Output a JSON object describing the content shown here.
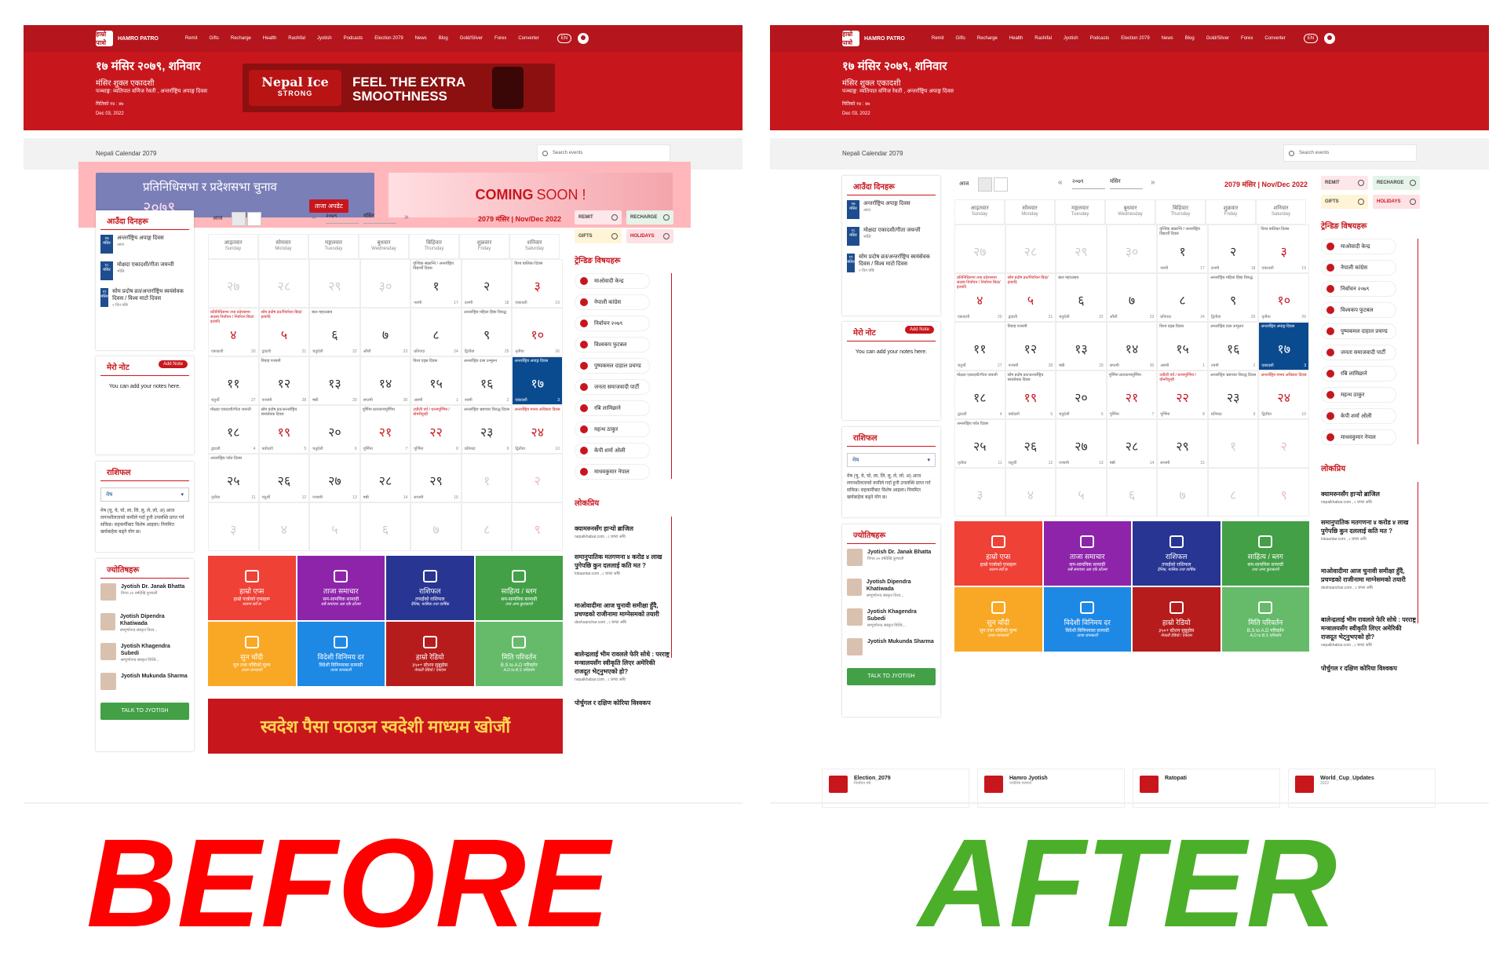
{
  "nav": {
    "brand": "HAMRO PATRO",
    "logo_text": "हाम्रो पात्रो",
    "items": [
      "Remit",
      "Gifts",
      "Recharge",
      "Health",
      "Rashifal",
      "Jyotish",
      "Podcasts",
      "Election 2079",
      "News",
      "Blog",
      "Gold/Silver",
      "Forex",
      "Converter"
    ],
    "lang": "EN"
  },
  "hero": {
    "date": "१७ मंसिर २०७९, शनिवार",
    "tithi": "मंसिर शुक्ल एकादशी",
    "event": "पञ्चाङ्ग: व्यतिपात वणिज रेवती , अन्तर्राष्ट्रिय अपाङ्ग दिवस",
    "sub": "मितिको १४ : ४७",
    "eng": "Dec 03, 2022",
    "ad_brand_1": "Nepal Ice",
    "ad_brand_2": "STRONG",
    "ad_tag": "FEEL THE EXTRA SMOOTHNESS"
  },
  "subheader": {
    "title": "Nepali Calendar 2079",
    "search_placeholder": "Search events"
  },
  "highlight_ads": {
    "election_1": "प्रतिनिधिसभा र प्रदेशसभा चुनाव",
    "election_2": "२०७९",
    "election_btn": "ताजा अपडेट",
    "coming_bold": "COMING",
    "coming_rest": "SOON !"
  },
  "upcoming": {
    "title": "आउँदा दिनहरू",
    "events": [
      {
        "badge": "१७ मंसिर",
        "text": "अन्तर्राष्ट्रिय अपाङ्ग दिवस",
        "sub": "आज"
      },
      {
        "badge": "१८ मंसिर",
        "text": "मोक्षदा एकादशी/गीता जयन्ती",
        "sub": "भोलि"
      },
      {
        "badge": "१९ मंसिर",
        "text": "सोम प्रदोष व्रत/अन्तर्राष्ट्रिय स्वयंसेवक दिवस / विश्व माटो दिवस",
        "sub": "२ दिन पछि"
      }
    ]
  },
  "notes": {
    "title": "मेरो नोट",
    "add": "Add Note",
    "empty": "You can add your notes here."
  },
  "rashifal": {
    "title": "राशिफल",
    "selected": "मेष",
    "text": "मेष (चु, चे, चो, ला, लि, लु, ले, लो, अ) आज लगनशीलताको कमीले गर्दा हुनी उपलब्धि प्राप्त गर्न सकिन्न। सहकर्मीबाट विशेष आइला। नियमित खर्चबाहेक बढ्ने योग छ।"
  },
  "jyotish": {
    "title": "ज्योतिषहरू",
    "before": [
      {
        "name": "Jyotish Dr. Janak Bhatta",
        "sub": "विगत ३५ वर्षदेखि कुण्डली"
      },
      {
        "name": "Jyotish Dipendra Khatiwada",
        "sub": "सम्पूर्णानन्द संस्कृत विश्व..."
      },
      {
        "name": "Jyotish Khagendra Subedi",
        "sub": "सम्पूर्णानन्द संस्कृत विश्वि..."
      },
      {
        "name": "Jyotish Mukunda Sharma",
        "sub": ""
      }
    ],
    "talk": "TALK TO JYOTISH"
  },
  "calendar": {
    "today_label": "आज",
    "year": "२०७९",
    "month": "मंसिर",
    "heading": "2079 मंसिर | Nov/Dec 2022",
    "days": [
      {
        "np": "आइतवार",
        "en": "Sunday"
      },
      {
        "np": "सोमवार",
        "en": "Monday"
      },
      {
        "np": "मङ्गलवार",
        "en": "Tuesday"
      },
      {
        "np": "बुधवार",
        "en": "Wednesday"
      },
      {
        "np": "बिहिवार",
        "en": "Thursday"
      },
      {
        "np": "शुक्रवार",
        "en": "Friday"
      },
      {
        "np": "शनिवार",
        "en": "Saturday"
      }
    ],
    "cells": [
      {
        "n": "२७",
        "f": true,
        "ev": "",
        "t": "",
        "e": ""
      },
      {
        "n": "२८",
        "f": true,
        "ev": "",
        "t": "",
        "e": ""
      },
      {
        "n": "२९",
        "f": true,
        "ev": "",
        "t": "",
        "e": ""
      },
      {
        "n": "३०",
        "f": true,
        "ev": "",
        "t": "",
        "e": ""
      },
      {
        "n": "१",
        "ev": "वृश्चिक संक्रान्ति / अन्तर्राष्ट्रिय विद्यार्थी दिवस",
        "t": "नवमी",
        "e": "17"
      },
      {
        "n": "२",
        "ev": "",
        "t": "दशमी",
        "e": "18"
      },
      {
        "n": "३",
        "r": true,
        "ev": "विश्व बालिका दिवस",
        "t": "एकादशी",
        "e": "19"
      },
      {
        "n": "४",
        "r": true,
        "ev": "प्रतिनिधिसभा तथा प्रदेशसभा सदस्य निर्वाचन / निर्वाचन बिदा/इत्यादि",
        "er": true,
        "t": "एकादशी",
        "e": "20"
      },
      {
        "n": "५",
        "r": true,
        "ev": "सोम प्रदोष व्रत/निर्वाचन बिदा/इत्यादि",
        "er": true,
        "t": "द्वादशी",
        "e": "21"
      },
      {
        "n": "६",
        "ev": "बाल महाउत्सव",
        "t": "चतुर्दशी",
        "e": "22"
      },
      {
        "n": "७",
        "ev": "",
        "t": "औंशी",
        "e": "23"
      },
      {
        "n": "८",
        "ev": "",
        "t": "प्रतिपदा",
        "e": "24"
      },
      {
        "n": "९",
        "ev": "अन्तर्राष्ट्रिय महिला हिंसा विरुद्ध",
        "t": "द्वितीया",
        "e": "25"
      },
      {
        "n": "१०",
        "r": true,
        "ev": "",
        "t": "तृतीया",
        "e": "26"
      },
      {
        "n": "११",
        "ev": "",
        "t": "चतुर्थी",
        "e": "27"
      },
      {
        "n": "१२",
        "ev": "विवाह पञ्चमी",
        "t": "पञ्चमी",
        "e": "28"
      },
      {
        "n": "१३",
        "ev": "",
        "t": "षष्ठी",
        "e": "29"
      },
      {
        "n": "१४",
        "ev": "",
        "t": "सप्तमी",
        "e": "30"
      },
      {
        "n": "१५",
        "ev": "विश्व एड्स दिवस",
        "t": "अष्टमी",
        "e": "1"
      },
      {
        "n": "१६",
        "ev": "अन्तर्राष्ट्रिय दास उन्मूलन",
        "t": "नवमी",
        "e": "2"
      },
      {
        "n": "१७",
        "today": true,
        "ev": "अन्तर्राष्ट्रिय अपाङ्ग दिवस",
        "t": "एकादशी",
        "e": "3"
      },
      {
        "n": "१८",
        "ev": "मोक्षदा एकादशी/गीता जयन्ती",
        "t": "द्वादशी",
        "e": "4"
      },
      {
        "n": "१९",
        "r": true,
        "ev": "सोम प्रदोष व्रत/अन्तर्राष्ट्रिय स्वयंसेवक दिवस",
        "t": "त्रयोदशी",
        "e": "5"
      },
      {
        "n": "२०",
        "ev": "",
        "t": "चतुर्दशी",
        "e": "6"
      },
      {
        "n": "२१",
        "r": true,
        "ev": "पूर्णिमा व्रत/धान्यपूर्णिमा",
        "t": "पूर्णिमा",
        "e": "7"
      },
      {
        "n": "२२",
        "r": true,
        "ev": "उधौली पर्व / धान्यपूर्णिमा / योमरीपुन्ही",
        "er": true,
        "t": "पूर्णिमा",
        "e": "8"
      },
      {
        "n": "२३",
        "ev": "अन्तर्राष्ट्रिय भ्रष्टाचार विरुद्ध दिवस",
        "t": "प्रतिपदा",
        "e": "9"
      },
      {
        "n": "२४",
        "r": true,
        "ev": "अन्तर्राष्ट्रिय मानव अधिकार दिवस",
        "er": true,
        "t": "द्वितीया",
        "e": "10"
      },
      {
        "n": "२५",
        "ev": "अन्तर्राष्ट्रिय पर्वत दिवस",
        "t": "तृतीया",
        "e": "11"
      },
      {
        "n": "२६",
        "ev": "",
        "t": "चतुर्थी",
        "e": "12"
      },
      {
        "n": "२७",
        "ev": "",
        "t": "पञ्चमी",
        "e": "13"
      },
      {
        "n": "२८",
        "ev": "",
        "t": "षष्ठी",
        "e": "14"
      },
      {
        "n": "२९",
        "ev": "",
        "t": "सप्तमी",
        "e": "15"
      },
      {
        "n": "१",
        "f": true,
        "ev": "",
        "t": "",
        "e": ""
      },
      {
        "n": "२",
        "f": true,
        "r": true,
        "ev": "",
        "t": "",
        "e": ""
      },
      {
        "n": "३",
        "f": true,
        "ev": "",
        "t": "",
        "e": ""
      },
      {
        "n": "४",
        "f": true,
        "ev": "",
        "t": "",
        "e": ""
      },
      {
        "n": "५",
        "f": true,
        "ev": "",
        "t": "",
        "e": ""
      },
      {
        "n": "६",
        "f": true,
        "ev": "",
        "t": "",
        "e": ""
      },
      {
        "n": "७",
        "f": true,
        "ev": "",
        "t": "",
        "e": ""
      },
      {
        "n": "८",
        "f": true,
        "ev": "",
        "t": "",
        "e": ""
      },
      {
        "n": "९",
        "f": true,
        "r": true,
        "ev": "",
        "t": "",
        "e": ""
      }
    ]
  },
  "tiles": [
    {
      "t": "हाम्रो एप्स",
      "s": "हाम्रो पात्रोको एप्सहरू",
      "s2": "सलग्न सर्वे छ",
      "c": "#ef4136"
    },
    {
      "t": "ताजा समाचार",
      "s": "सम-सामयिक सामाग्री",
      "s2": "सबै समाचार अब एकै ठाँउमा",
      "c": "#8e24aa"
    },
    {
      "t": "राशिफल",
      "s": "तपाईंको राशिफल",
      "s2": "दैनिक, मासिक तथा वार्षिक",
      "c": "#283593"
    },
    {
      "t": "साहित्य / ब्लग",
      "s": "सम-सामयिक सामाग्री",
      "s2": "तथा अन्य कुराकानी",
      "c": "#43a047"
    },
    {
      "t": "सुन चाँदी",
      "s": "सुन तथा चाँदीको मूल्य",
      "s2": "ताजा जानकारी",
      "c": "#f9a825"
    },
    {
      "t": "विदेशी विनिमय दर",
      "s": "विदेशी विनिमयका सामाग्री",
      "s2": "ताजा जानकारी",
      "c": "#1e88e5"
    },
    {
      "t": "हाम्रो रेडियो",
      "s": "३५०+ स्टेशन सुन्नुहोस",
      "s2": "नेपाली रेडियो / एफएम",
      "c": "#b71c1c"
    },
    {
      "t": "मिति परिवर्तन",
      "s": "B.S to A.D परिवर्तन",
      "s2": "A.D to B.S परिवर्तन",
      "c": "#66bb6a"
    }
  ],
  "bottom_ad": "स्वदेश पैसा पठाउन स्वदेशी माध्यम खोजौं",
  "chips": [
    {
      "label": "REMIT",
      "c": "#fde7ea"
    },
    {
      "label": "RECHARGE",
      "c": "#e5f3e8"
    },
    {
      "label": "GIFTS",
      "c": "#fff5d6"
    },
    {
      "label": "HOLIDAYS",
      "c": "#fde1e4"
    }
  ],
  "trending": {
    "title": "ट्रेन्डिङ विषयहरू",
    "items": [
      "माओवादी केन्द्र",
      "नेपाली कांग्रेस",
      "निर्वाचन २०७९",
      "विश्वकप फुटबल",
      "पुष्पकमल दाहाल प्रचण्ड",
      "जनता समाजवादी पार्टी",
      "रबि लामिछाने",
      "महन्थ ठाकुर",
      "केपी शर्मा ओली",
      "माधवकुमार नेपाल"
    ]
  },
  "popular": {
    "title": "लोकप्रिय",
    "items": [
      {
        "t": "क्यामरुनसँग हार्‍यो ब्राजिल",
        "s": "nepalkhabar.com , ८ घण्टा अघि"
      },
      {
        "t": "समानुपातिक मतगणना ४ करोड ४ लाख पुगेपछि कुन दललाई कति मत ?",
        "s": "lokaantar.com , ८ घण्टा अघि"
      },
      {
        "t": "माओवादीमा आज चुनावी समीक्षा हुँदै, प्रचण्डको राजीनामा माग्नेसमको तयारी",
        "s": "deshsanchar.com , ८ घण्टा अघि"
      },
      {
        "t": "बालेन्द्रलाई भीम रावलले फेरि सोधे : परराष्ट्र मन्त्रालयसँग स्वीकृति लिएर अमेरिकी राजदूत भेट्नुभएको हो?",
        "s": "nepalkhabar.com , ८ घण्टा अघि"
      },
      {
        "t": "पोर्चुगल र दक्षिण कोरिया विश्वकप",
        "s": ""
      }
    ]
  },
  "footer_cards": [
    {
      "t": "Election_2079",
      "s": "निर्वाचन वर्ष"
    },
    {
      "t": "Hamro Jyotish",
      "s": "ज्योतिष परामर्श"
    },
    {
      "t": "Ratopati",
      "s": ""
    },
    {
      "t": "World_Cup_Updates",
      "s": "2022"
    }
  ],
  "labels": {
    "before": "BEFORE",
    "after": "AFTER"
  },
  "colors": {
    "brand_red": "#c8161d",
    "today_blue": "#0a4a8f",
    "before_red": "#ff0000",
    "after_green": "#4caf2a"
  }
}
